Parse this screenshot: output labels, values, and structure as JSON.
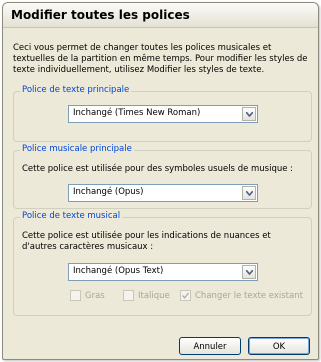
{
  "dialog": {
    "title": "Modifier toutes les polices",
    "intro": "Ceci vous permet de changer toutes les polices musicales et textuelles de la partition en même temps. Pour modifier les styles de texte individuellement, utilisez Modifier les styles de texte."
  },
  "groups": {
    "main_text": {
      "legend": "Police de texte principale",
      "select_value": "Inchangé (Times New Roman)"
    },
    "main_music": {
      "legend": "Police musicale principale",
      "description": "Cette police est utilisée pour des symboles usuels de musique :",
      "select_value": "Inchangé (Opus)"
    },
    "music_text": {
      "legend": "Police de texte musical",
      "description": "Cette police est utilisée pour les indications de nuances et d'autres caractères musicaux :",
      "select_value": "Inchangé (Opus Text)",
      "checkboxes": {
        "bold": {
          "label": "Gras",
          "checked": false
        },
        "italic": {
          "label": "Italique",
          "checked": false
        },
        "change_existing": {
          "label": "Changer le texte existant",
          "checked": true
        }
      }
    }
  },
  "buttons": {
    "cancel": "Annuler",
    "ok": "OK"
  },
  "colors": {
    "dialog_bg": "#ece9d8",
    "legend_text": "#0046d5",
    "disabled_text": "#a7a69b",
    "button_border": "#003c74"
  }
}
